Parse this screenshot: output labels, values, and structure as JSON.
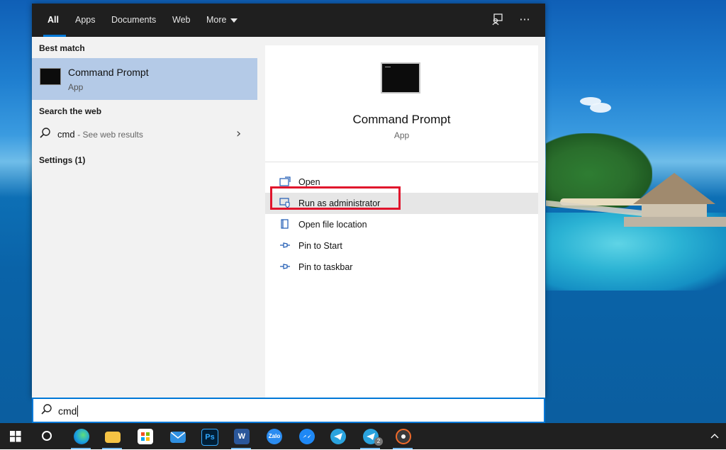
{
  "tabs": [
    {
      "label": "All"
    },
    {
      "label": "Apps"
    },
    {
      "label": "Documents"
    },
    {
      "label": "Web"
    },
    {
      "label": "More"
    }
  ],
  "topbar_icons": [
    "feedback-icon",
    "more-options-icon"
  ],
  "left": {
    "best_match_label": "Best match",
    "best_match": {
      "title": "Command Prompt",
      "subtitle": "App"
    },
    "search_web_label": "Search the web",
    "web_result": {
      "query": "cmd",
      "suffix": "- See web results"
    },
    "settings_label": "Settings (1)"
  },
  "preview": {
    "title": "Command Prompt",
    "subtitle": "App"
  },
  "actions": [
    {
      "label": "Open",
      "icon": "open-icon"
    },
    {
      "label": "Run as administrator",
      "icon": "admin-shield-icon"
    },
    {
      "label": "Open file location",
      "icon": "file-location-icon"
    },
    {
      "label": "Pin to Start",
      "icon": "pin-icon"
    },
    {
      "label": "Pin to taskbar",
      "icon": "pin-icon"
    }
  ],
  "search": {
    "value": "cmd"
  },
  "taskbar": {
    "items": [
      {
        "name": "start-button",
        "icon": "windows-logo-icon"
      },
      {
        "name": "cortana-button",
        "icon": "cortana-circle-icon"
      },
      {
        "name": "edge",
        "icon": "edge-icon",
        "color": "#1aa0e0"
      },
      {
        "name": "file-explorer",
        "icon": "folder-icon",
        "color": "#f6c344"
      },
      {
        "name": "store",
        "icon": "store-bag-icon",
        "color": "#ffffff"
      },
      {
        "name": "mail",
        "icon": "mail-icon",
        "color": "#2f8fe0"
      },
      {
        "name": "photoshop",
        "icon": "photoshop-icon",
        "label": "Ps",
        "color": "#001e36"
      },
      {
        "name": "word",
        "icon": "word-icon",
        "label": "W",
        "color": "#2b579a"
      },
      {
        "name": "zalo",
        "icon": "zalo-icon",
        "label": "Zalo",
        "color": "#2b8cf0"
      },
      {
        "name": "messenger",
        "icon": "messenger-icon",
        "color": "#1e88f5"
      },
      {
        "name": "telegram",
        "icon": "telegram-icon",
        "color": "#2aa3de"
      },
      {
        "name": "telegram-2",
        "icon": "telegram-icon",
        "color": "#2aa3de",
        "badge": "2"
      },
      {
        "name": "media-player",
        "icon": "media-player-icon",
        "color": "#f06a2a"
      }
    ],
    "tray_icon": "chevron-up-icon"
  }
}
